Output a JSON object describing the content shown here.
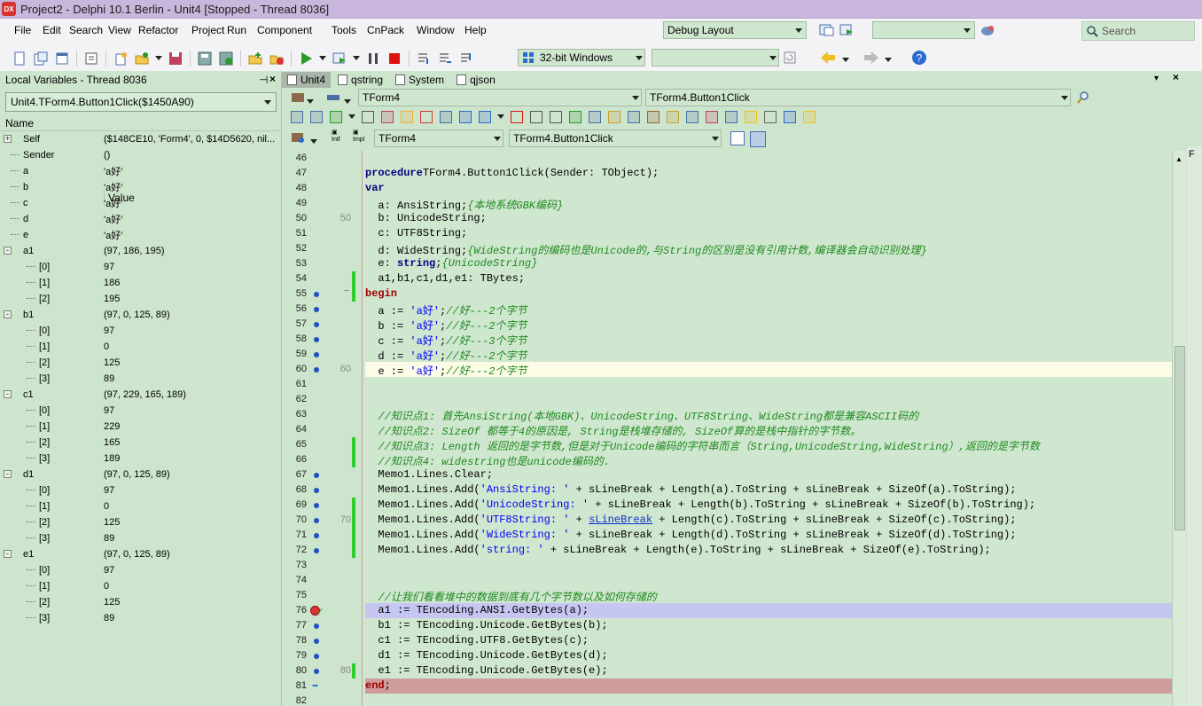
{
  "window": {
    "title": "Project2 - Delphi 10.1 Berlin - Unit4 [Stopped - Thread 8036]",
    "app_icon_text": "DX"
  },
  "menu": [
    "File",
    "Edit",
    "Search",
    "View",
    "Refactor",
    "Project",
    "Run",
    "Component",
    "Tools",
    "CnPack",
    "Window",
    "Help"
  ],
  "toolbar": {
    "layout_combo": "Debug Layout",
    "platform_combo": "32-bit Windows",
    "search_placeholder": "Search"
  },
  "locals": {
    "panel_title": "Local Variables - Thread 8036",
    "frame_combo": "Unit4.TForm4.Button1Click($1450A90)",
    "col_name": "Name",
    "col_value": "Value",
    "rows": [
      {
        "name": "Self",
        "value": "($148CE10, 'Form4', 0, $14D5620, nil...",
        "indent": 0,
        "exp": "+"
      },
      {
        "name": "Sender",
        "value": "()",
        "indent": 1,
        "exp": ""
      },
      {
        "name": "a",
        "value": "'a好'",
        "indent": 1,
        "exp": ""
      },
      {
        "name": "b",
        "value": "'a好'",
        "indent": 1,
        "exp": ""
      },
      {
        "name": "c",
        "value": "'a好'",
        "indent": 1,
        "exp": ""
      },
      {
        "name": "d",
        "value": "'a好'",
        "indent": 1,
        "exp": ""
      },
      {
        "name": "e",
        "value": "'a好'",
        "indent": 1,
        "exp": ""
      },
      {
        "name": "a1",
        "value": "(97, 186, 195)",
        "indent": 0,
        "exp": "-"
      },
      {
        "name": "[0]",
        "value": "97",
        "indent": 2,
        "exp": ""
      },
      {
        "name": "[1]",
        "value": "186",
        "indent": 2,
        "exp": ""
      },
      {
        "name": "[2]",
        "value": "195",
        "indent": 2,
        "exp": ""
      },
      {
        "name": "b1",
        "value": "(97, 0, 125, 89)",
        "indent": 0,
        "exp": "-"
      },
      {
        "name": "[0]",
        "value": "97",
        "indent": 2,
        "exp": ""
      },
      {
        "name": "[1]",
        "value": "0",
        "indent": 2,
        "exp": ""
      },
      {
        "name": "[2]",
        "value": "125",
        "indent": 2,
        "exp": ""
      },
      {
        "name": "[3]",
        "value": "89",
        "indent": 2,
        "exp": ""
      },
      {
        "name": "c1",
        "value": "(97, 229, 165, 189)",
        "indent": 0,
        "exp": "-"
      },
      {
        "name": "[0]",
        "value": "97",
        "indent": 2,
        "exp": ""
      },
      {
        "name": "[1]",
        "value": "229",
        "indent": 2,
        "exp": ""
      },
      {
        "name": "[2]",
        "value": "165",
        "indent": 2,
        "exp": ""
      },
      {
        "name": "[3]",
        "value": "189",
        "indent": 2,
        "exp": ""
      },
      {
        "name": "d1",
        "value": "(97, 0, 125, 89)",
        "indent": 0,
        "exp": "-"
      },
      {
        "name": "[0]",
        "value": "97",
        "indent": 2,
        "exp": ""
      },
      {
        "name": "[1]",
        "value": "0",
        "indent": 2,
        "exp": ""
      },
      {
        "name": "[2]",
        "value": "125",
        "indent": 2,
        "exp": ""
      },
      {
        "name": "[3]",
        "value": "89",
        "indent": 2,
        "exp": ""
      },
      {
        "name": "e1",
        "value": "(97, 0, 125, 89)",
        "indent": 0,
        "exp": "-"
      },
      {
        "name": "[0]",
        "value": "97",
        "indent": 2,
        "exp": ""
      },
      {
        "name": "[1]",
        "value": "0",
        "indent": 2,
        "exp": ""
      },
      {
        "name": "[2]",
        "value": "125",
        "indent": 2,
        "exp": ""
      },
      {
        "name": "[3]",
        "value": "89",
        "indent": 2,
        "exp": ""
      }
    ]
  },
  "editor_tabs": [
    "Unit4",
    "qstring",
    "System",
    "qjson"
  ],
  "editor_combos": {
    "class_combo": "TForm4",
    "method_combo": "TForm4.Button1Click",
    "class_combo2": "TForm4",
    "method_combo2": "TForm4.Button1Click"
  },
  "code": [
    {
      "n": "46",
      "dot": false,
      "chg": false,
      "hl": "",
      "t": []
    },
    {
      "n": "47",
      "dot": false,
      "chg": false,
      "hl": "",
      "t": [
        [
          "kw",
          "procedure"
        ],
        [
          "",
          "TForm4.Button1Click(Sender: TObject);"
        ]
      ]
    },
    {
      "n": "48",
      "dot": false,
      "chg": false,
      "hl": "",
      "t": [
        [
          "kw",
          "var"
        ]
      ]
    },
    {
      "n": "49",
      "dot": false,
      "chg": false,
      "hl": "",
      "t": [
        [
          "",
          "  a: AnsiString;"
        ],
        [
          "cmt",
          "{本地系统GBK编码}"
        ]
      ]
    },
    {
      "n": "50",
      "dot": false,
      "chg": false,
      "hl": "",
      "t": [
        [
          "",
          "  b: UnicodeString;"
        ]
      ],
      "ten": "50"
    },
    {
      "n": "51",
      "dot": false,
      "chg": false,
      "hl": "",
      "t": [
        [
          "",
          "  c: UTF8String;"
        ]
      ]
    },
    {
      "n": "52",
      "dot": false,
      "chg": false,
      "hl": "",
      "t": [
        [
          "",
          "  d: WideString;"
        ],
        [
          "cmt",
          "{WideString的编码也是Unicode的,与String的区别是没有引用计数,编译器会自动识别处理}"
        ]
      ]
    },
    {
      "n": "53",
      "dot": false,
      "chg": false,
      "hl": "",
      "t": [
        [
          "",
          "  e: "
        ],
        [
          "kw",
          "string"
        ],
        [
          "",
          ";"
        ],
        [
          "cmt",
          "{UnicodeString}"
        ]
      ]
    },
    {
      "n": "54",
      "dot": false,
      "chg": true,
      "hl": "",
      "t": [
        [
          "",
          "  a1,b1,c1,d1,e1: TBytes;"
        ]
      ]
    },
    {
      "n": "55",
      "dot": true,
      "chg": true,
      "hl": "",
      "t": [
        [
          "kwred",
          "begin"
        ]
      ]
    },
    {
      "n": "56",
      "dot": true,
      "chg": false,
      "hl": "",
      "t": [
        [
          "",
          "  a := "
        ],
        [
          "str",
          "'a好'"
        ],
        [
          "",
          ";"
        ],
        [
          "cmt",
          "//好---2个字节"
        ]
      ]
    },
    {
      "n": "57",
      "dot": true,
      "chg": false,
      "hl": "",
      "t": [
        [
          "",
          "  b := "
        ],
        [
          "str",
          "'a好'"
        ],
        [
          "",
          ";"
        ],
        [
          "cmt",
          "//好---2个字节"
        ]
      ]
    },
    {
      "n": "58",
      "dot": true,
      "chg": false,
      "hl": "",
      "t": [
        [
          "",
          "  c := "
        ],
        [
          "str",
          "'a好'"
        ],
        [
          "",
          ";"
        ],
        [
          "cmt",
          "//好---3个字节"
        ]
      ]
    },
    {
      "n": "59",
      "dot": true,
      "chg": false,
      "hl": "",
      "t": [
        [
          "",
          "  d := "
        ],
        [
          "str",
          "'a好'"
        ],
        [
          "",
          ";"
        ],
        [
          "cmt",
          "//好---2个字节"
        ]
      ]
    },
    {
      "n": "60",
      "dot": true,
      "chg": false,
      "hl": "cur",
      "t": [
        [
          "",
          "  e := "
        ],
        [
          "str",
          "'a好'"
        ],
        [
          "",
          ";"
        ],
        [
          "cmt",
          "//好---2个字节"
        ]
      ],
      "ten": "60"
    },
    {
      "n": "61",
      "dot": false,
      "chg": false,
      "hl": "",
      "t": []
    },
    {
      "n": "62",
      "dot": false,
      "chg": false,
      "hl": "",
      "t": []
    },
    {
      "n": "63",
      "dot": false,
      "chg": false,
      "hl": "",
      "t": [
        [
          "cmt",
          "  //知识点1: 首先AnsiString(本地GBK)、UnicodeString、UTF8String、WideString都是兼容ASCII码的"
        ]
      ]
    },
    {
      "n": "64",
      "dot": false,
      "chg": false,
      "hl": "",
      "t": [
        [
          "cmt",
          "  //知识点2: SizeOf 都等于4的原因是, String是栈堆存储的, SizeOf算的是栈中指针的字节数。"
        ]
      ]
    },
    {
      "n": "65",
      "dot": false,
      "chg": true,
      "hl": "",
      "t": [
        [
          "cmt",
          "  //知识点3: Length 返回的是字节数,但是对于Unicode编码的字符串而言（String,UnicodeString,WideString）,返回的是字节数"
        ]
      ]
    },
    {
      "n": "66",
      "dot": false,
      "chg": true,
      "hl": "",
      "t": [
        [
          "cmt",
          "  //知识点4: widestring也是unicode编码的."
        ]
      ]
    },
    {
      "n": "67",
      "dot": true,
      "chg": false,
      "hl": "",
      "t": [
        [
          "",
          "  Memo1.Lines.Clear;"
        ]
      ]
    },
    {
      "n": "68",
      "dot": true,
      "chg": false,
      "hl": "",
      "t": [
        [
          "",
          "  Memo1.Lines.Add("
        ],
        [
          "str",
          "'AnsiString: '"
        ],
        [
          "",
          " + sLineBreak + Length(a).ToString + sLineBreak + SizeOf(a).ToString);"
        ]
      ]
    },
    {
      "n": "69",
      "dot": true,
      "chg": true,
      "hl": "",
      "t": [
        [
          "",
          "  Memo1.Lines.Add("
        ],
        [
          "str",
          "'UnicodeString: '"
        ],
        [
          "",
          " + sLineBreak + Length(b).ToString + sLineBreak + SizeOf(b).ToString);"
        ]
      ]
    },
    {
      "n": "70",
      "dot": true,
      "chg": true,
      "hl": "",
      "t": [
        [
          "",
          "  Memo1.Lines.Add("
        ],
        [
          "str",
          "'UTF8String: '"
        ],
        [
          "",
          " + "
        ],
        [
          "lnk",
          "sLineBreak"
        ],
        [
          "",
          " + Length(c).ToString + sLineBreak + SizeOf(c).ToString);"
        ]
      ],
      "ten": "70"
    },
    {
      "n": "71",
      "dot": true,
      "chg": true,
      "hl": "",
      "t": [
        [
          "",
          "  Memo1.Lines.Add("
        ],
        [
          "str",
          "'WideString: '"
        ],
        [
          "",
          " + sLineBreak + Length(d).ToString + sLineBreak + SizeOf(d).ToString);"
        ]
      ]
    },
    {
      "n": "72",
      "dot": true,
      "chg": true,
      "hl": "",
      "t": [
        [
          "",
          "  Memo1.Lines.Add("
        ],
        [
          "str",
          "'string: '"
        ],
        [
          "",
          " + sLineBreak + Length(e).ToString + sLineBreak + SizeOf(e).ToString);"
        ]
      ]
    },
    {
      "n": "73",
      "dot": false,
      "chg": false,
      "hl": "",
      "t": []
    },
    {
      "n": "74",
      "dot": false,
      "chg": false,
      "hl": "",
      "t": []
    },
    {
      "n": "75",
      "dot": false,
      "chg": false,
      "hl": "",
      "t": [
        [
          "cmt",
          "  //让我们看看堆中的数据到底有几个字节数以及如何存储的"
        ]
      ]
    },
    {
      "n": "76",
      "dot": false,
      "chg": false,
      "hl": "bp",
      "t": [
        [
          "",
          "  a1 := TEncoding.ANSI.GetBytes(a);"
        ]
      ]
    },
    {
      "n": "77",
      "dot": true,
      "chg": false,
      "hl": "",
      "t": [
        [
          "",
          "  b1 := TEncoding.Unicode.GetBytes(b);"
        ]
      ]
    },
    {
      "n": "78",
      "dot": true,
      "chg": false,
      "hl": "",
      "t": [
        [
          "",
          "  c1 := TEncoding.UTF8.GetBytes(c);"
        ]
      ]
    },
    {
      "n": "79",
      "dot": true,
      "chg": false,
      "hl": "",
      "t": [
        [
          "",
          "  d1 := TEncoding.Unicode.GetBytes(d);"
        ]
      ]
    },
    {
      "n": "80",
      "dot": true,
      "chg": true,
      "hl": "",
      "t": [
        [
          "",
          "  e1 := TEncoding.Unicode.GetBytes(e);"
        ]
      ],
      "ten": "80"
    },
    {
      "n": "81",
      "dot": false,
      "chg": false,
      "hl": "end",
      "t": [
        [
          "kwred",
          "end"
        ],
        [
          "",
          ";"
        ]
      ]
    },
    {
      "n": "82",
      "dot": false,
      "chg": false,
      "hl": "",
      "t": []
    }
  ]
}
